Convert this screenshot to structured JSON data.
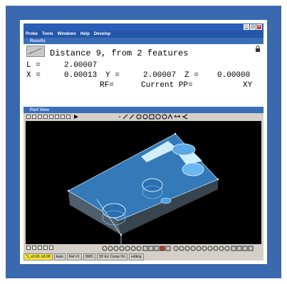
{
  "menu": [
    "Probe",
    "Tools",
    "Windows",
    "Help",
    "Develop"
  ],
  "titlebar_buttons": {
    "minimize": "_",
    "maximize": "□",
    "close": "×"
  },
  "results_panel": {
    "title": "Results"
  },
  "measurement": {
    "heading": "Distance 9, from 2 features",
    "l_label": "L =",
    "l_value": "2.00007",
    "x_label": "X =",
    "x_value": "0.00013",
    "y_label": "Y =",
    "y_value": "2.00007",
    "z_label": "Z =",
    "z_value": "0.00000",
    "rf_label": "RF=",
    "pp_label": "Current PP=",
    "pp_value": "XY"
  },
  "part_view_panel": {
    "title": "Part View"
  },
  "status": [
    "\"1_x0.00, k0.00",
    "Auto",
    "Ref #1",
    "DMS",
    "3D Err Comp On",
    "editing"
  ],
  "icons": [
    "feature-icon",
    "lock-icon",
    "line-tool-icon",
    "circle-tool-icon",
    "zoom-icon",
    "rotate-icon"
  ],
  "colors": {
    "accent_frame": "#3b69b0",
    "titlebar": "#2a5db5",
    "part_blue": "#3d8fd8",
    "viewport_bg": "#000000",
    "status_highlight": "#f5e63c"
  }
}
